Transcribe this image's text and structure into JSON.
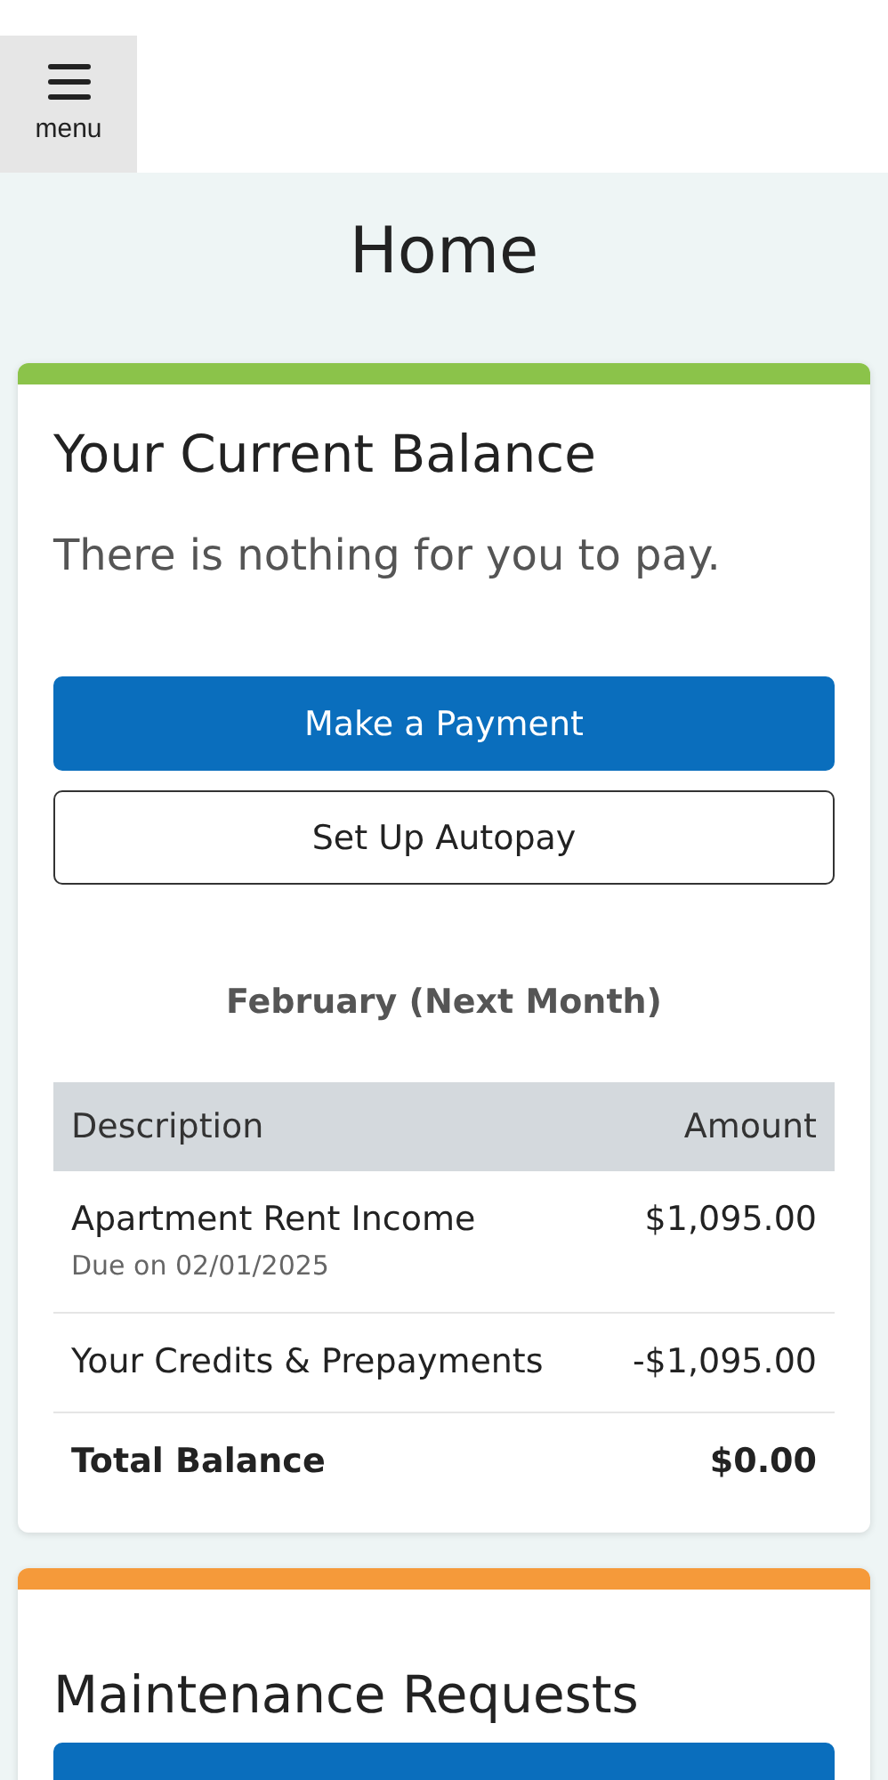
{
  "header": {
    "menu_label": "menu"
  },
  "page_title": "Home",
  "balance_card": {
    "title": "Your Current Balance",
    "message": "There is nothing for you to pay.",
    "buttons": [
      {
        "label": "Make a Payment",
        "kind": "primary"
      },
      {
        "label": "Set Up Autopay",
        "kind": "secondary"
      }
    ],
    "period": "February (Next Month)",
    "table": {
      "columns": [
        "Description",
        "Amount"
      ],
      "rows": [
        {
          "description": "Apartment Rent Income",
          "note": "Due on 02/01/2025",
          "amount": "$1,095.00",
          "kind": "item"
        },
        {
          "description": "Your Credits & Prepayments",
          "amount": "-$1,095.00",
          "kind": "item"
        },
        {
          "description": "Total Balance",
          "amount": "$0.00",
          "kind": "total"
        }
      ]
    }
  },
  "maintenance_card": {
    "title": "Maintenance Requests"
  }
}
